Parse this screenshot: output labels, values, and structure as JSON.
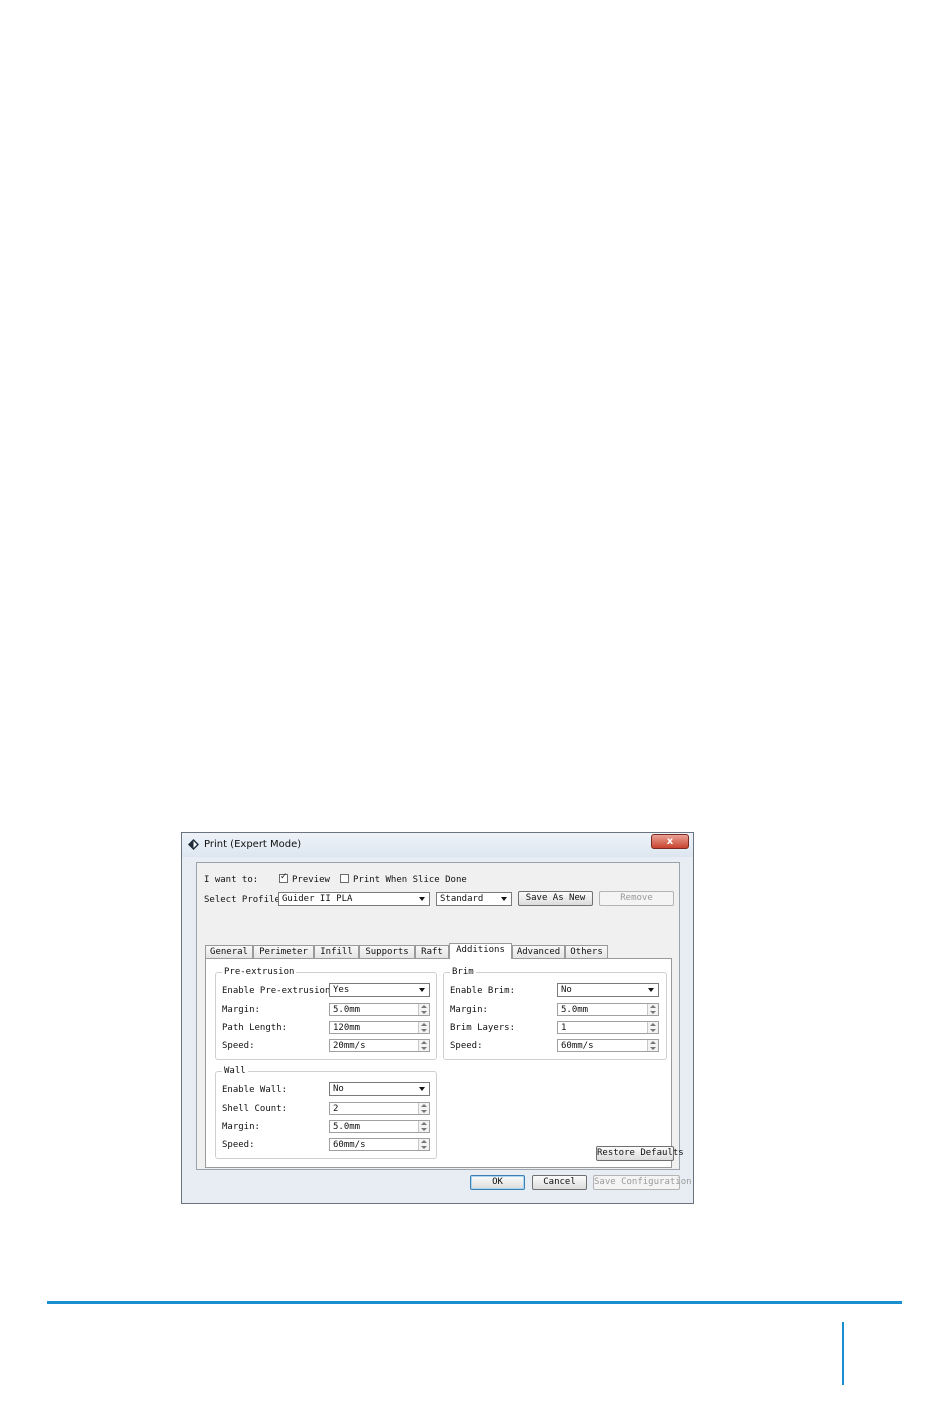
{
  "window": {
    "title": "Print (Expert Mode)",
    "close_glyph": "x"
  },
  "top": {
    "i_want_to_label": "I want to:",
    "preview_label": "Preview",
    "preview_checked": true,
    "print_when_done_label": "Print When Slice Done",
    "print_when_done_checked": false,
    "select_profile_label": "Select Profile:",
    "profile_value": "Guider II PLA",
    "quality_value": "Standard",
    "save_as_new_label": "Save As New",
    "remove_label": "Remove"
  },
  "tabs": [
    "General",
    "Perimeter",
    "Infill",
    "Supports",
    "Raft",
    "Additions",
    "Advanced",
    "Others"
  ],
  "active_tab": "Additions",
  "pre_extrusion": {
    "title": "Pre-extrusion",
    "enable_label": "Enable Pre-extrusion:",
    "enable_value": "Yes",
    "margin_label": "Margin:",
    "margin_value": "5.0mm",
    "path_length_label": "Path Length:",
    "path_length_value": "120mm",
    "speed_label": "Speed:",
    "speed_value": "20mm/s"
  },
  "brim": {
    "title": "Brim",
    "enable_label": "Enable Brim:",
    "enable_value": "No",
    "margin_label": "Margin:",
    "margin_value": "5.0mm",
    "layers_label": "Brim Layers:",
    "layers_value": "1",
    "speed_label": "Speed:",
    "speed_value": "60mm/s"
  },
  "wall": {
    "title": "Wall",
    "enable_label": "Enable Wall:",
    "enable_value": "No",
    "shell_label": "Shell Count:",
    "shell_value": "2",
    "margin_label": "Margin:",
    "margin_value": "5.0mm",
    "speed_label": "Speed:",
    "speed_value": "60mm/s"
  },
  "restore_defaults_label": "Restore Defaults",
  "buttons": {
    "ok": "OK",
    "cancel": "Cancel",
    "save_configuration": "Save Configuration"
  },
  "colors": {
    "footer_accent": "#1a8fd0"
  }
}
